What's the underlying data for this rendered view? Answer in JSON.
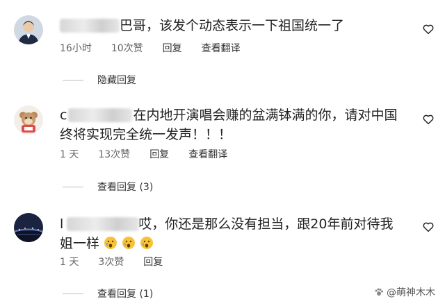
{
  "comments": [
    {
      "text": "巴哥，该发个动态表示一下祖国统一了",
      "time": "16小时",
      "likes": "10次赞",
      "reply": "回复",
      "translate": "查看翻译",
      "replies_toggle": "隐藏回复"
    },
    {
      "name_fragment": "c",
      "text": "在内地开演唱会赚的盆满钵满的你，请对中国终将实现完全统一发声！！！",
      "time": "1 天",
      "likes": "13次赞",
      "reply": "回复",
      "translate": "查看翻译",
      "replies_toggle": "查看回复 (3)"
    },
    {
      "name_fragment": "l",
      "text": "哎，你还是那么没有担当，跟20年前对待我姐一样",
      "time": "1 天",
      "likes": "3次赞",
      "reply": "回复",
      "replies_toggle": "查看回复 (1)"
    }
  ],
  "watermark": "@萌神木木",
  "icons": {
    "like": "heart-outline-icon",
    "emoji": "crying-face-emoji"
  }
}
